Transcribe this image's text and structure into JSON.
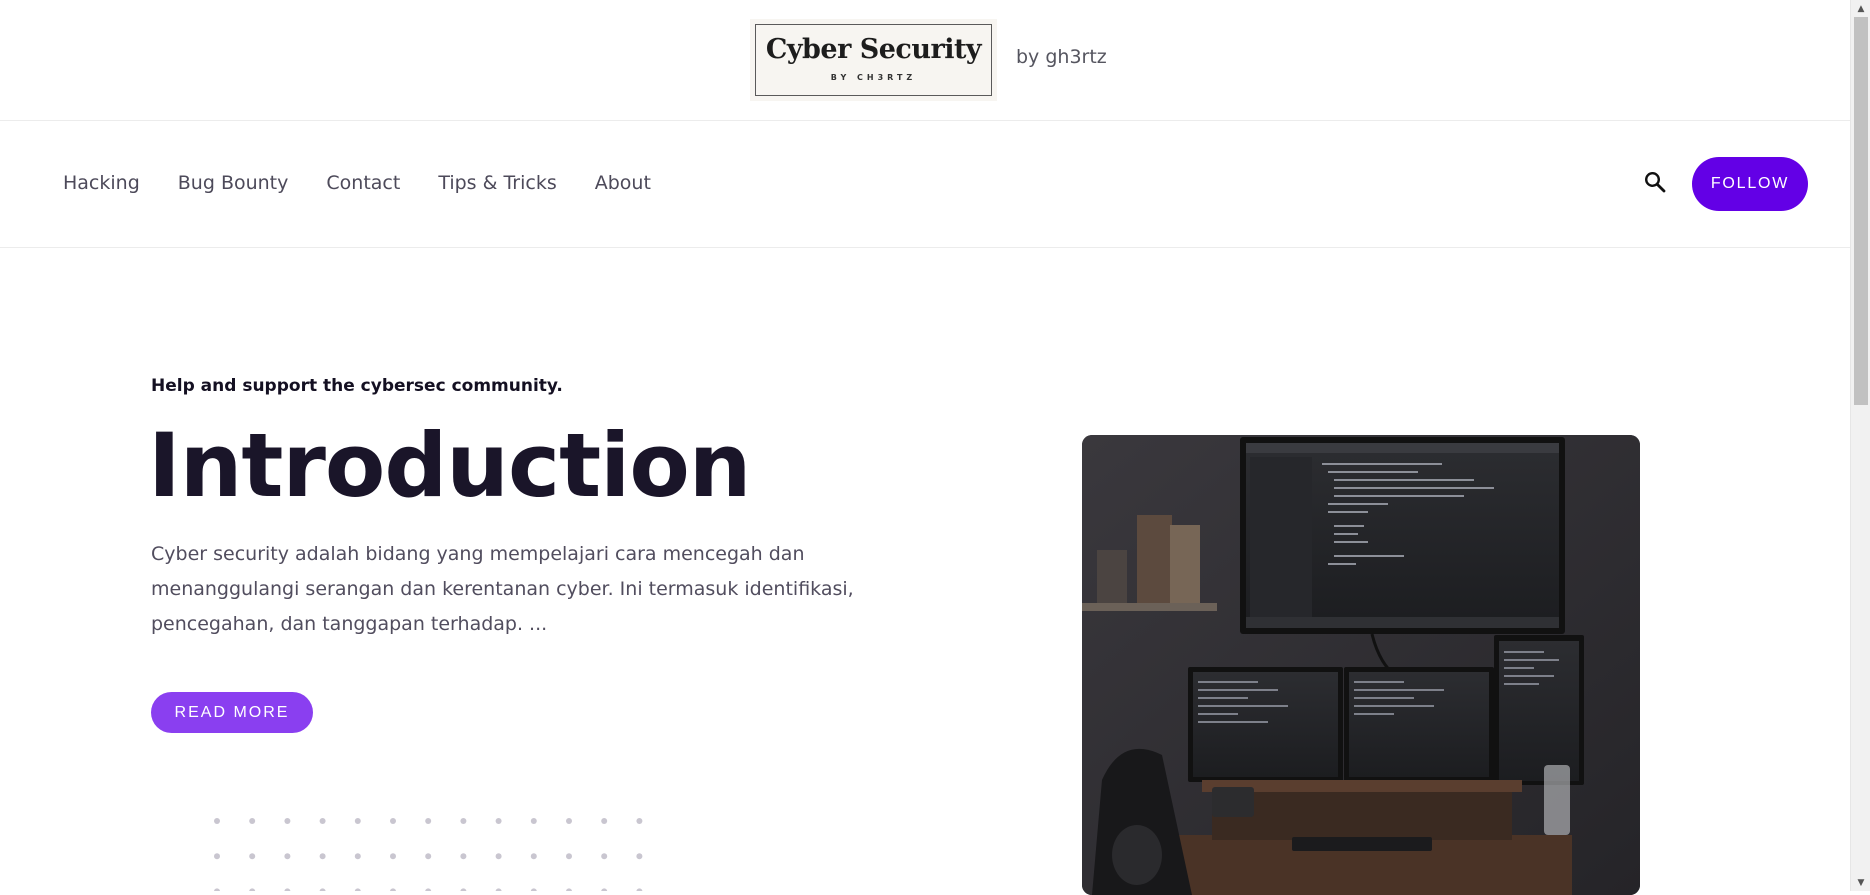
{
  "header": {
    "logo_title": "Cyber Security",
    "logo_subtitle": "BY CH3RTZ",
    "byline": "by gh3rtz"
  },
  "nav": {
    "items": [
      {
        "label": "Hacking"
      },
      {
        "label": "Bug Bounty"
      },
      {
        "label": "Contact"
      },
      {
        "label": "Tips & Tricks"
      },
      {
        "label": "About"
      }
    ],
    "search_icon": "search-icon",
    "follow_label": "FOLLOW"
  },
  "hero": {
    "tagline": "Help and support the cybersec community.",
    "title": "Introduction",
    "description": "Cyber security adalah bidang yang mempelajari cara mencegah dan menanggulangi serangan dan kerentanan cyber. Ini termasuk identifikasi, pencegahan, dan tanggapan terhadap. ...",
    "read_more_label": "READ MORE"
  },
  "colors": {
    "follow_button": "#6300e6",
    "read_more_button": "#8a3ff0",
    "title_text": "#1a1529"
  }
}
